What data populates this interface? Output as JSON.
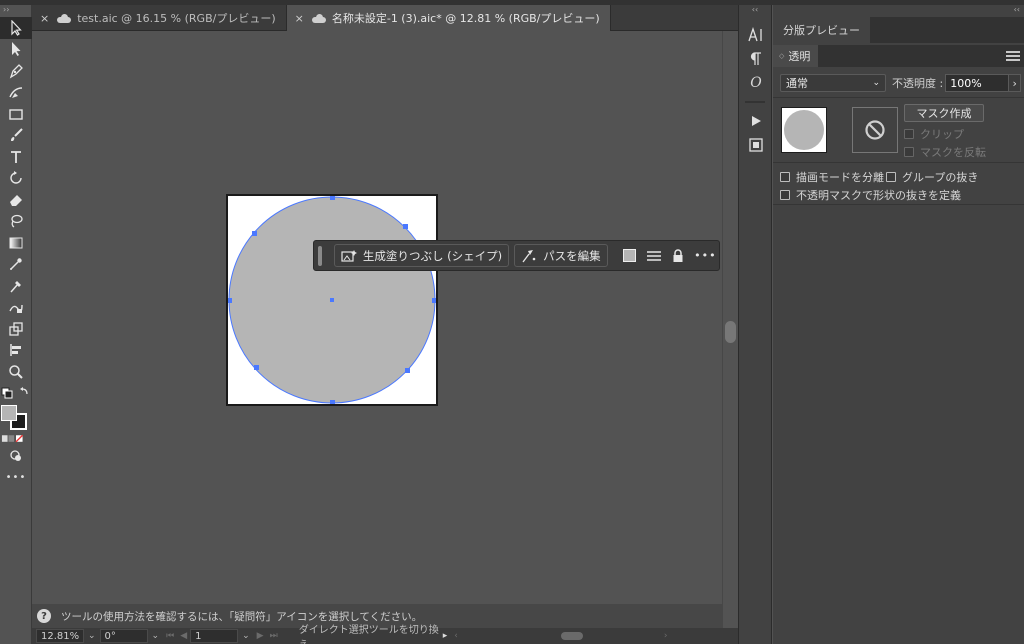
{
  "tabs": [
    {
      "close": "×",
      "label": "test.aic @ 16.15 % (RGB/プレビュー)"
    },
    {
      "close": "×",
      "label": "名称未設定-1 (3).aic* @ 12.81 % (RGB/プレビュー)"
    }
  ],
  "toolbar": {
    "collapse": "››",
    "tools": [
      "selection-tool",
      "direct-selection-tool",
      "pen-tool",
      "curvature-tool",
      "rectangle-tool",
      "brush-tool",
      "type-tool",
      "rotate-tool",
      "eraser-tool",
      "lasso-tool",
      "gradient-tool",
      "eyedropper-tool",
      "eyedropper-alt-tool",
      "shape-builder-tool",
      "scale-tool",
      "align-tool",
      "zoom-tool"
    ],
    "more": "•••"
  },
  "context_bar": {
    "generative_fill_label": "生成塗りつぶし (シェイプ)",
    "edit_path_label": "パスを編集",
    "more": "•••"
  },
  "hint": {
    "icon": "?",
    "text": "ツールの使用方法を確認するには、「疑問符」アイコンを選択してください。"
  },
  "statusbar": {
    "zoom": "12.81%",
    "rotation": "0°",
    "artboard": "1",
    "tool_status": "ダイレクト選択ツールを切り換え"
  },
  "middock": {
    "collapse": "‹‹",
    "icons": [
      "character-icon",
      "paragraph-icon",
      "opentype-icon",
      "actions-icon",
      "artboards-icon"
    ]
  },
  "rightpanel": {
    "collapse": "‹‹",
    "top_tab": "分版プレビュー",
    "panel_tab": "透明",
    "blend_mode": "通常",
    "opacity_label": "不透明度 :",
    "opacity_value": "100%",
    "make_mask_button": "マスク作成",
    "clip_label": "クリップ",
    "invert_mask_label": "マスクを反転",
    "isolate_blending_label": "描画モードを分離",
    "knockout_group_label": "グループの抜き",
    "opacity_mask_define_label": "不透明マスクで形状の抜きを定義"
  },
  "colors": {
    "accent_anchor": "#4a78ff",
    "shape_fill": "#b5b5b5"
  }
}
